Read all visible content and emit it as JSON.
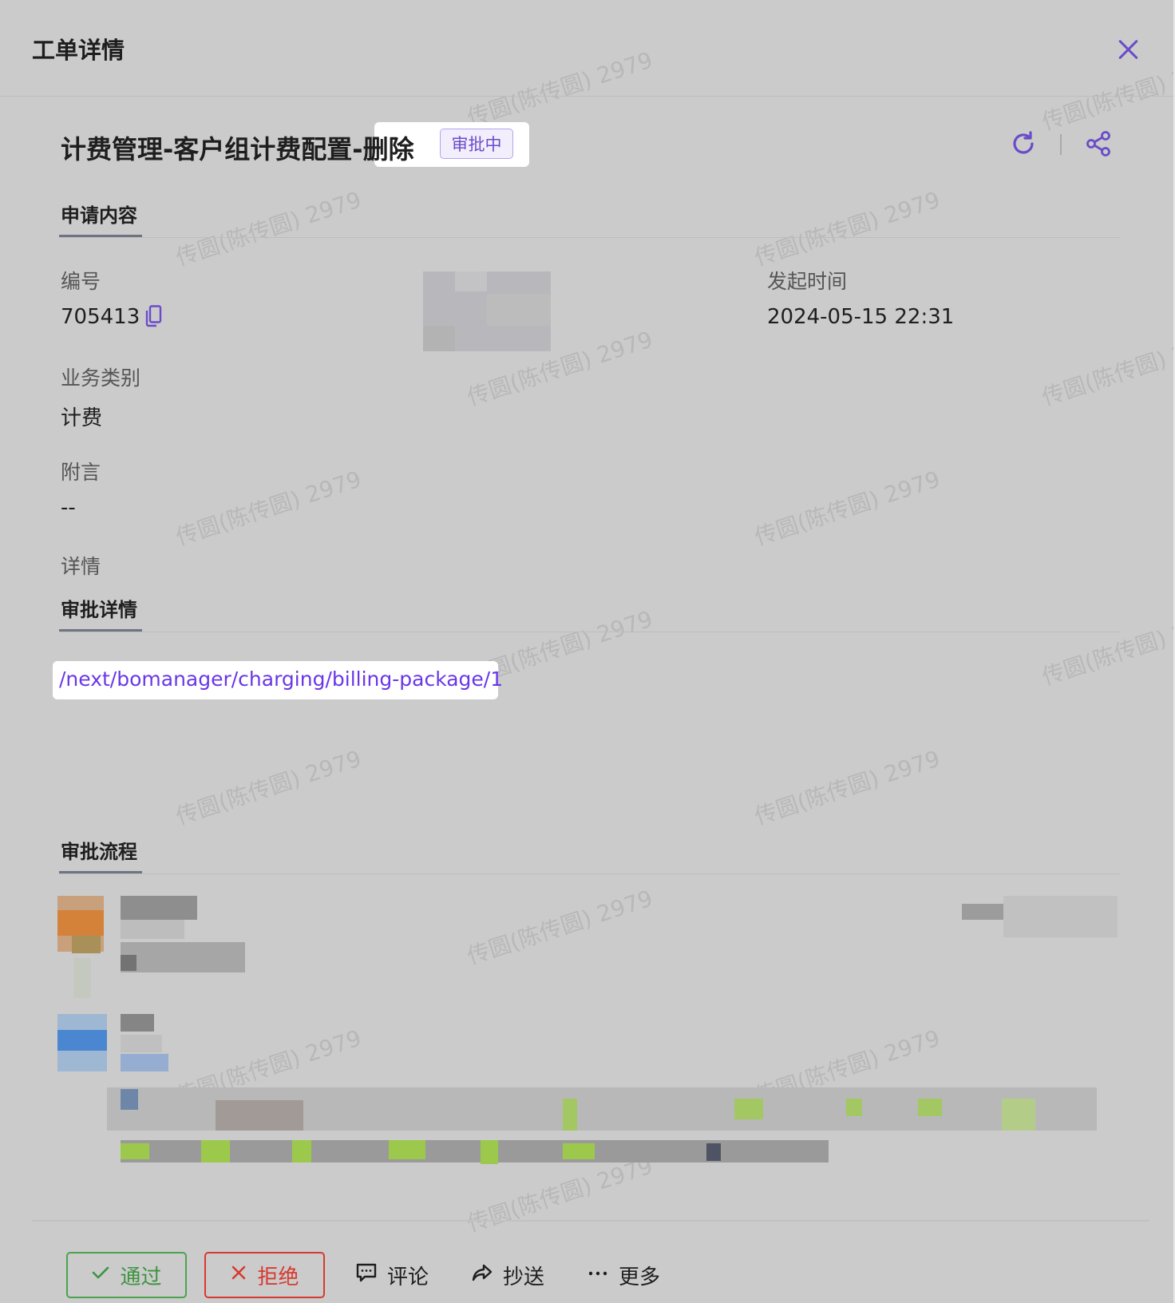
{
  "header": {
    "title": "工单详情",
    "close_icon": "close-icon"
  },
  "ticket": {
    "title": "计费管理-客户组计费配置-删除",
    "status": "审批中",
    "actions": [
      "refresh-icon",
      "share-icon"
    ]
  },
  "colors": {
    "accent": "#6a4cc9",
    "link": "#6a37e8",
    "approve": "#3d9440",
    "reject": "#d63a2f"
  },
  "application": {
    "heading": "申请内容",
    "fields": {
      "id_label": "编号",
      "id_value": "705413",
      "applicant_label": "",
      "time_label": "发起时间",
      "time_value": "2024-05-15 22:31",
      "category_label": "业务类别",
      "category_value": "计费",
      "note_label": "附言",
      "note_value": "--",
      "detail_label": "详情"
    }
  },
  "approval_detail": {
    "heading": "审批详情",
    "link": "/next/bomanager/charging/billing-package/1"
  },
  "approval_flow": {
    "heading": "审批流程"
  },
  "watermark": "传圆(陈传圆) 2979",
  "footer": {
    "approve": "通过",
    "reject": "拒绝",
    "comment": "评论",
    "cc": "抄送",
    "more": "更多"
  }
}
